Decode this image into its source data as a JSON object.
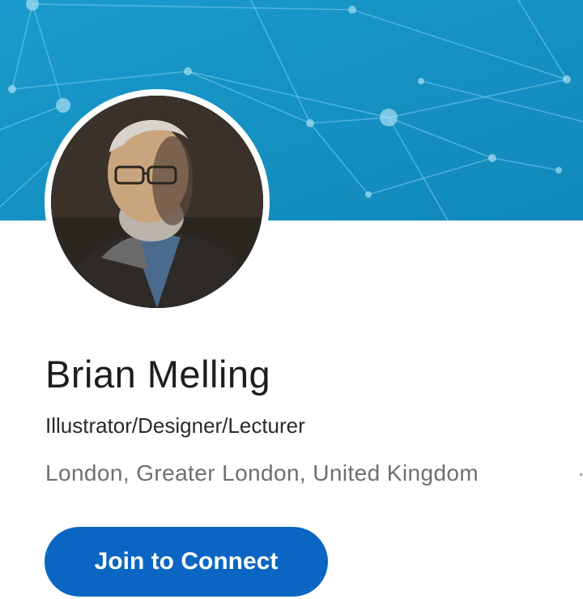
{
  "profile": {
    "name": "Brian Melling",
    "headline": "Illustrator/Designer/Lecturer",
    "location": "London, Greater London, United Kingdom",
    "location_separator": "·",
    "join_label": "Join to Connect",
    "avatar_icon": "person-avatar-photo",
    "banner_icon": "network-pattern-banner"
  },
  "colors": {
    "banner": "#1591c2",
    "button": "#0a66c2",
    "button_text": "#ffffff",
    "name_text": "#1d1d1d",
    "location_text": "#6f6f6f"
  }
}
